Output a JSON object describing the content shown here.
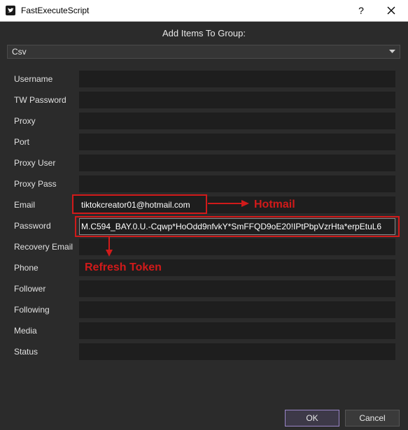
{
  "window": {
    "title": "FastExecuteScript",
    "help_label": "?"
  },
  "dialog": {
    "header": "Add Items To Group:",
    "format_select": {
      "value": "Csv"
    }
  },
  "fields": [
    {
      "label": "Username",
      "value": ""
    },
    {
      "label": "TW Password",
      "value": ""
    },
    {
      "label": "Proxy",
      "value": ""
    },
    {
      "label": "Port",
      "value": ""
    },
    {
      "label": "Proxy User",
      "value": ""
    },
    {
      "label": "Proxy Pass",
      "value": ""
    },
    {
      "label": "Email",
      "value": "tiktokcreator01@hotmail.com"
    },
    {
      "label": "Password",
      "value": "M.C594_BAY.0.U.-Cqwp*HoOdd9nfvkY*SmFFQD9oE20!IPtPbpVzrHta*erpEtuL6"
    },
    {
      "label": "Recovery Email",
      "value": ""
    },
    {
      "label": "Phone",
      "value": ""
    },
    {
      "label": "Follower",
      "value": ""
    },
    {
      "label": "Following",
      "value": ""
    },
    {
      "label": "Media",
      "value": ""
    },
    {
      "label": "Status",
      "value": ""
    }
  ],
  "annotations": {
    "email_note": "Hotmail",
    "password_note": "Refresh Token",
    "color": "#d11a1a"
  },
  "buttons": {
    "ok": "OK",
    "cancel": "Cancel"
  },
  "icons": {
    "app": "twitter-bird-icon",
    "close": "close-icon",
    "dropdown": "chevron-down-icon"
  }
}
